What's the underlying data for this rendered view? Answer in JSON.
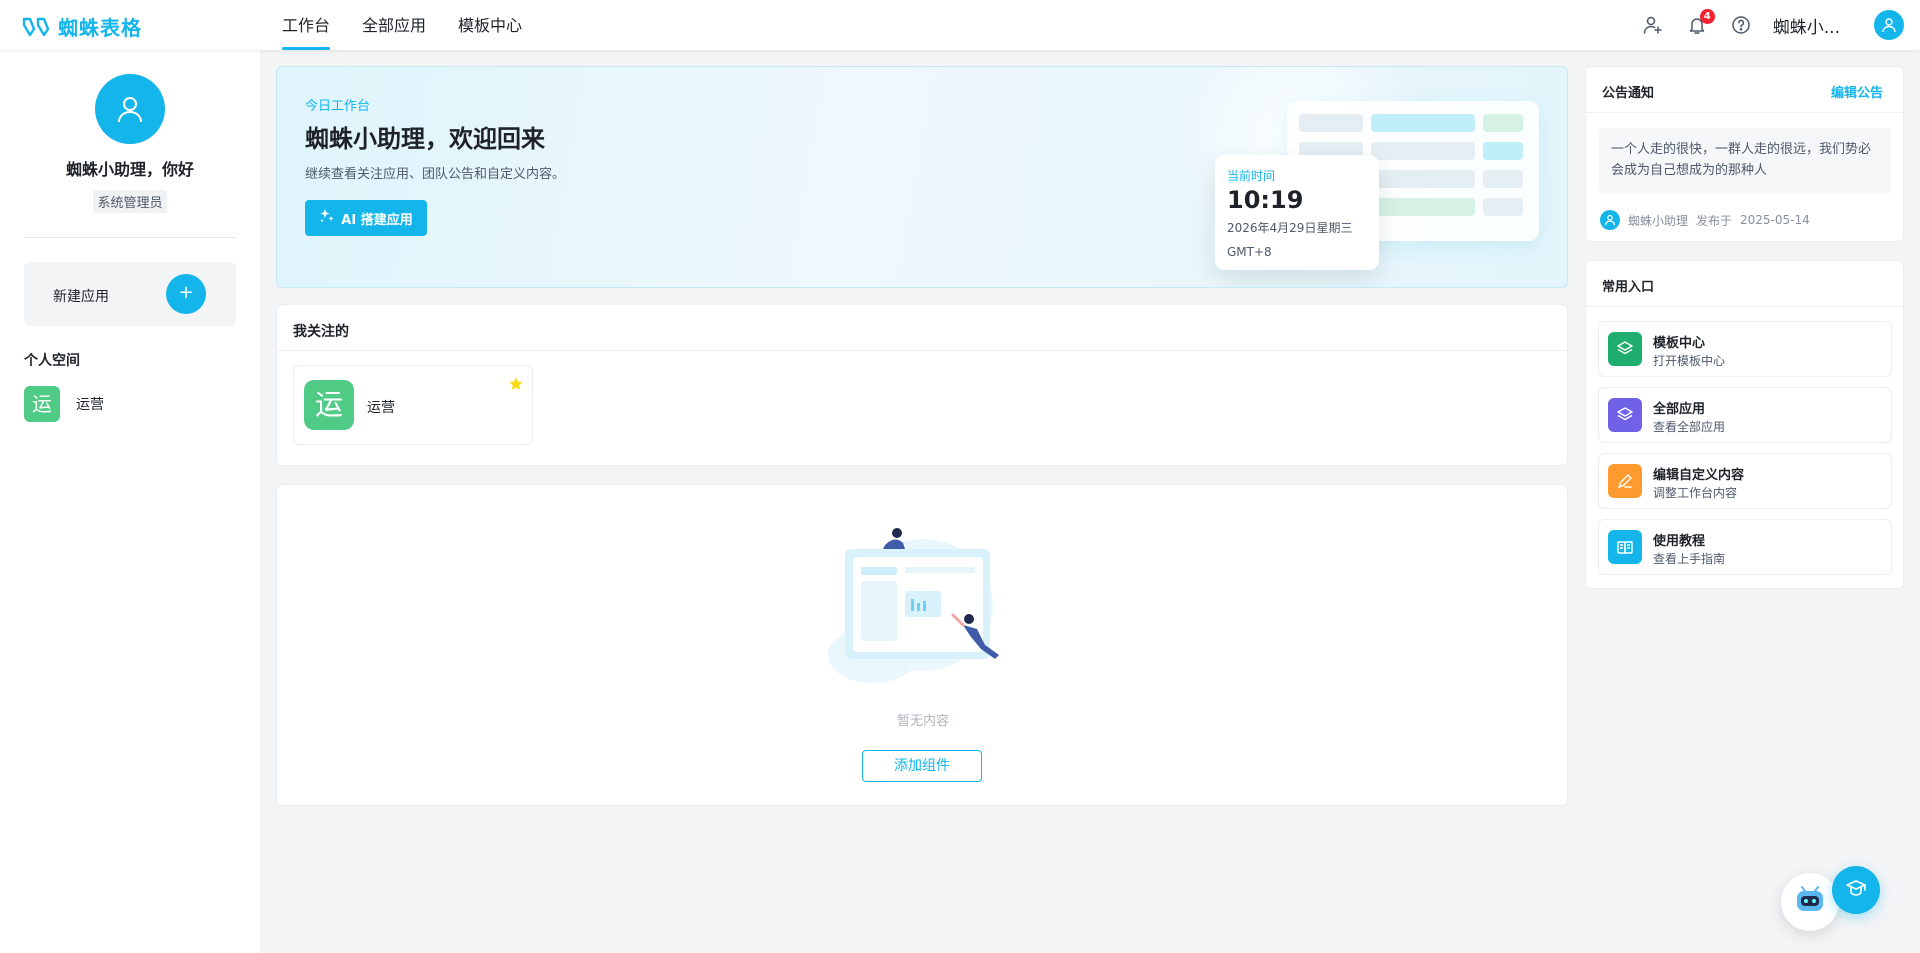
{
  "app": {
    "logo_text": "蜘蛛表格",
    "brand_color": "#13b5ea"
  },
  "nav": {
    "tabs": [
      {
        "label": "工作台",
        "active": true
      },
      {
        "label": "全部应用",
        "active": false
      },
      {
        "label": "模板中心",
        "active": false
      }
    ]
  },
  "topbar": {
    "notification_count": "4",
    "user_name": "蜘蛛小...",
    "icons": [
      "add-user-icon",
      "bell-icon",
      "help-icon",
      "user-avatar-icon"
    ]
  },
  "sidebar": {
    "greeting": "蜘蛛小助理，你好",
    "role": "系统管理员",
    "new_app_label": "新建应用",
    "new_app_button": "+",
    "section_title": "个人空间",
    "apps": [
      {
        "icon_char": "运",
        "label": "运营",
        "color": "#4fcb86"
      }
    ]
  },
  "hero": {
    "kicker": "今日工作台",
    "title": "蜘蛛小助理，欢迎回来",
    "subtitle": "继续查看关注应用、团队公告和自定义内容。",
    "ai_button": "AI 搭建应用",
    "clock": {
      "label": "当前时间",
      "time": "10:19",
      "date": "2026年4月29日星期三",
      "timezone": "GMT+8"
    }
  },
  "follow": {
    "title": "我关注的",
    "items": [
      {
        "icon_char": "运",
        "label": "运营",
        "starred": true,
        "color": "#4fcb86"
      }
    ]
  },
  "empty": {
    "text": "暂无内容",
    "button": "添加组件"
  },
  "notice": {
    "title": "公告通知",
    "edit_link": "编辑公告",
    "body": "一个人走的很快，一群人走的很远，我们势必会成为自己想成为的那种人",
    "author": "蜘蛛小助理",
    "published_prefix": "发布于",
    "date": "2025-05-14"
  },
  "shortcuts": {
    "title": "常用入口",
    "items": [
      {
        "title": "模板中心",
        "desc": "打开模板中心",
        "icon": "layers-icon",
        "color": "#1fae6e"
      },
      {
        "title": "全部应用",
        "desc": "查看全部应用",
        "icon": "layers-icon",
        "color": "#6f62e6"
      },
      {
        "title": "编辑自定义内容",
        "desc": "调整工作台内容",
        "icon": "edit-icon",
        "color": "#ff9a2e"
      },
      {
        "title": "使用教程",
        "desc": "查看上手指南",
        "icon": "book-icon",
        "color": "#13b5ea"
      }
    ]
  }
}
